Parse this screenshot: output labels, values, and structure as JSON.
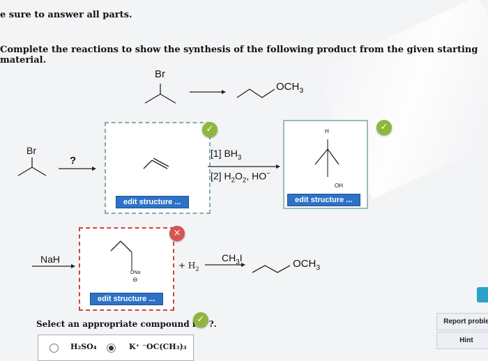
{
  "header": {
    "instruction_1": "e sure to answer all parts.",
    "instruction_2": "Complete the reactions to show the synthesis of the following product from the given starting material."
  },
  "overall": {
    "start_label": "Br",
    "product_label": "OCH",
    "product_sub": "3"
  },
  "step1": {
    "start_label": "Br",
    "question_mark": "?",
    "box1_button": "edit structure ...",
    "reagent_line1_prefix": "[1] BH",
    "reagent_line1_sub": "3",
    "reagent_line2_prefix": "[2] H",
    "reagent_line2_sub1": "2",
    "reagent_line2_mid": "O",
    "reagent_line2_sub2": "2",
    "reagent_line2_suffix": ", HO",
    "reagent_line2_sup": "−",
    "box2_label_h": "H",
    "box2_label_oh": "OH",
    "box2_button": "edit structure ..."
  },
  "step2": {
    "reagent_left": "NaH",
    "box_label_ona": "ONa",
    "box_label_minus": "⊖",
    "box_button": "edit structure ...",
    "plus_h2": "+ H",
    "plus_h2_sub": "2",
    "reagent_right_prefix": "CH",
    "reagent_right_sub": "3",
    "reagent_right_suffix": "I",
    "product_label": "OCH",
    "product_sub": "3"
  },
  "question": {
    "prompt": "Select an appropriate compound for ?.",
    "option1_label": "H₂SO₄",
    "option2_label": "K⁺ ⁻OC(CH₃)₃",
    "selected": "option2"
  },
  "side": {
    "report_button": "Report proble",
    "hint_button": "Hint"
  },
  "status": {
    "box1": "correct",
    "box2": "correct",
    "box3": "incorrect",
    "radio": "correct"
  },
  "colors": {
    "button_blue": "#2e72c7",
    "check_green": "#8fb73c",
    "error_red": "#d9534f"
  }
}
